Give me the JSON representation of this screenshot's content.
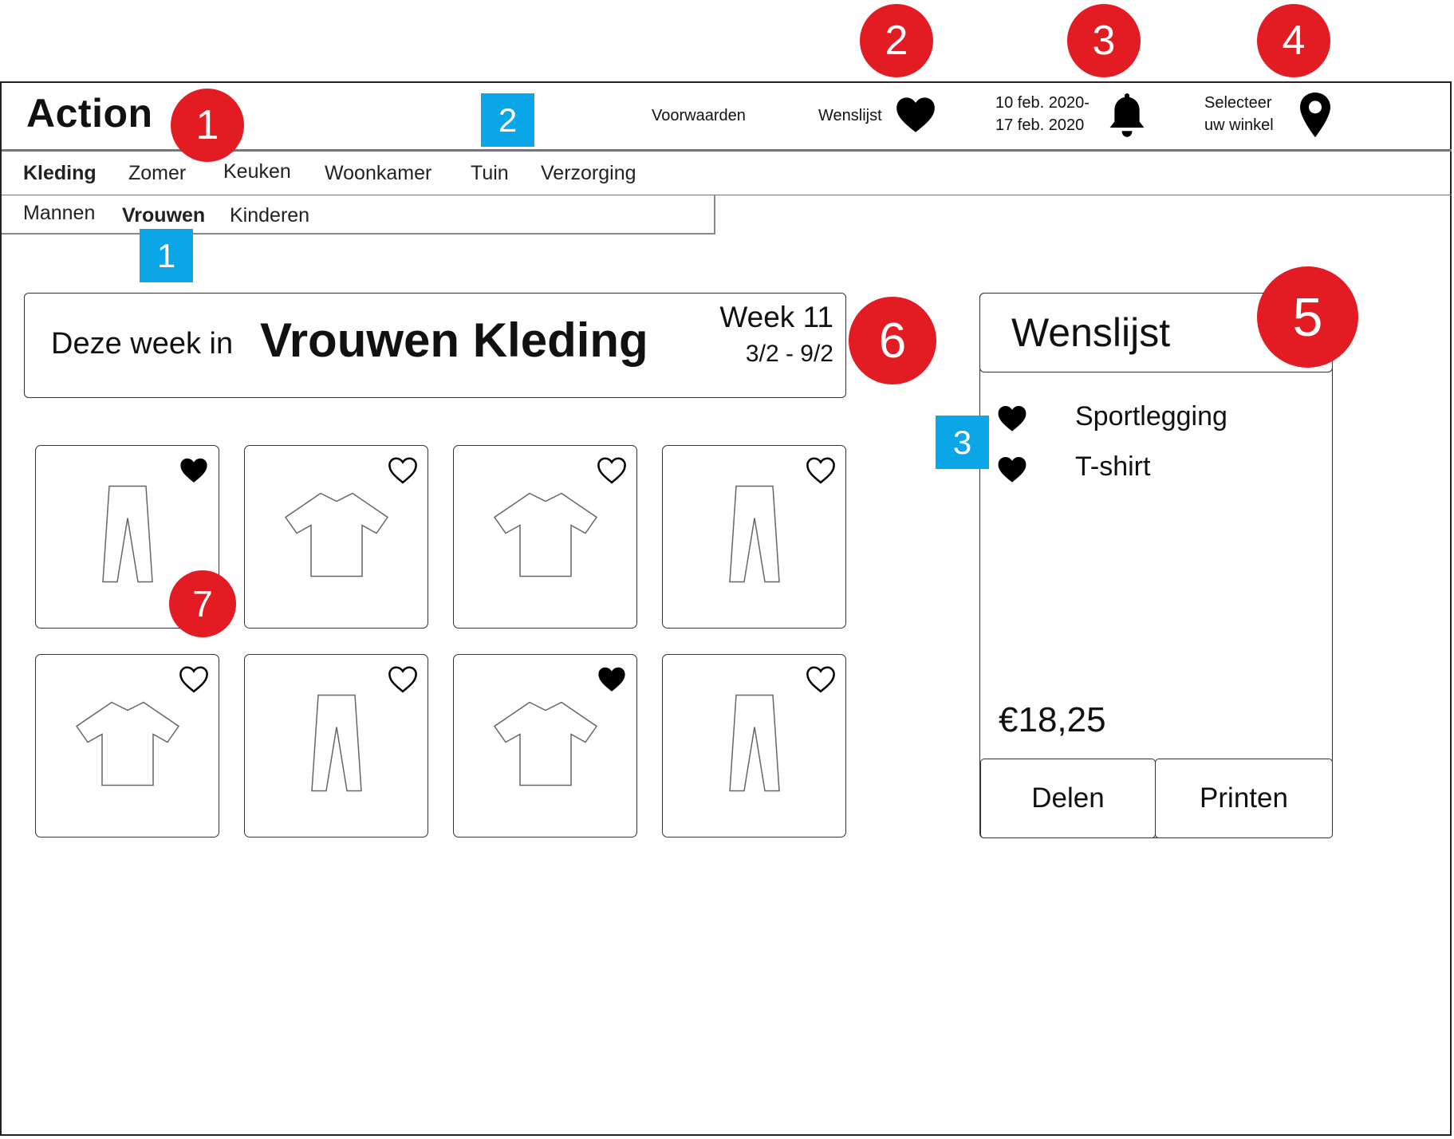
{
  "header": {
    "logo": "Action",
    "links": {
      "terms": "Voorwaarden",
      "wishlist": "Wenslijst"
    },
    "date_range": [
      "10 feb. 2020-",
      "17 feb. 2020"
    ],
    "store_select": [
      "Selecteer",
      "uw winkel"
    ]
  },
  "nav": {
    "items": [
      "Kleding",
      "Zomer",
      "Keuken",
      "Woonkamer",
      "Tuin",
      "Verzorging"
    ],
    "active": "Kleding"
  },
  "subnav": {
    "items": [
      "Mannen",
      "Vrouwen",
      "Kinderen"
    ],
    "active": "Vrouwen"
  },
  "banner": {
    "prefix": "Deze week in",
    "title": "Vrouwen Kleding",
    "week": "Week 11",
    "dates": "3/2 - 9/2"
  },
  "products": [
    {
      "type": "pants",
      "favorited": true
    },
    {
      "type": "shirt",
      "favorited": false
    },
    {
      "type": "shirt",
      "favorited": false
    },
    {
      "type": "pants",
      "favorited": false
    },
    {
      "type": "shirt",
      "favorited": false
    },
    {
      "type": "pants",
      "favorited": false
    },
    {
      "type": "shirt",
      "favorited": true
    },
    {
      "type": "pants",
      "favorited": false
    }
  ],
  "wishlist_panel": {
    "title": "Wenslijst",
    "items": [
      "Sportlegging",
      "T-shirt"
    ],
    "total": "€18,25",
    "share_label": "Delen",
    "print_label": "Printen"
  },
  "annotations": {
    "red": [
      "1",
      "2",
      "3",
      "4",
      "5",
      "6",
      "7"
    ],
    "blue": [
      "1",
      "2",
      "3"
    ]
  },
  "colors": {
    "annotation_red": "#e31b23",
    "annotation_blue": "#0aa6e8"
  },
  "icons": {
    "favorite": "heart-icon",
    "notifications": "bell-icon",
    "store": "map-pin-icon"
  }
}
